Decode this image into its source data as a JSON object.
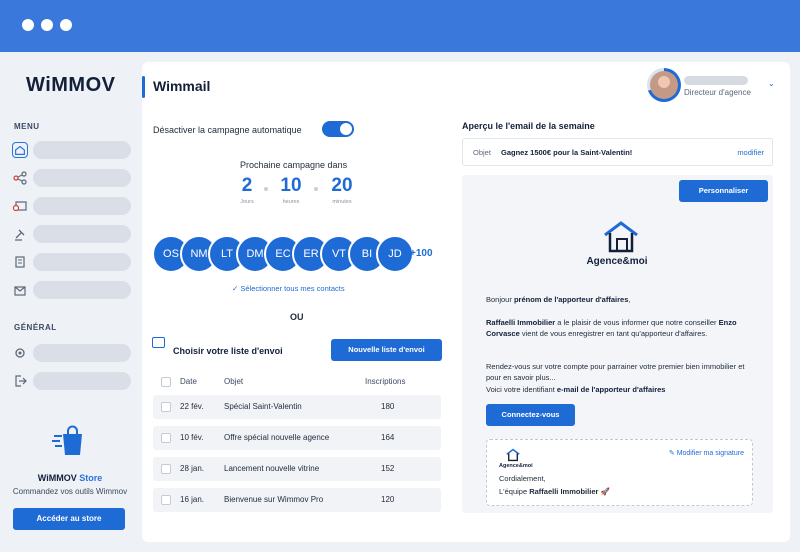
{
  "app": {
    "logo": "WiMMOV",
    "page_title": "Wimmail"
  },
  "user": {
    "role": "Directeur d'agence",
    "chevron": "⌄"
  },
  "sidebar": {
    "menu_label": "MENU",
    "general_label": "GÉNÉRAL",
    "menu_items": [
      {
        "icon": "home-icon"
      },
      {
        "icon": "share-icon"
      },
      {
        "icon": "mail-share-icon"
      },
      {
        "icon": "gavel-icon"
      },
      {
        "icon": "document-icon"
      },
      {
        "icon": "inbox-icon"
      }
    ],
    "general_items": [
      {
        "icon": "gear-icon"
      },
      {
        "icon": "logout-icon"
      }
    ],
    "store": {
      "title_part1": "WiMMOV",
      "title_part2": " Store",
      "subtitle": "Commandez vos outils Wimmov",
      "button": "Accéder au store"
    }
  },
  "campaign": {
    "toggle_label": "Désactiver la campagne automatique",
    "toggle_on": true,
    "next_label": "Prochaine campagne dans",
    "countdown": [
      {
        "value": "2",
        "unit": "Jours"
      },
      {
        "value": "10",
        "unit": "heures"
      },
      {
        "value": "20",
        "unit": "minutes"
      }
    ],
    "contacts": [
      "OS",
      "NM",
      "LT",
      "DM",
      "EC",
      "ER",
      "VT",
      "BI",
      "JD"
    ],
    "more_contacts": "+100",
    "select_all": "✓  Sélectionner tous mes contacts",
    "or": "OU"
  },
  "lists": {
    "title": "Choisir votre liste d'envoi",
    "new_button": "Nouvelle liste d'envoi",
    "headers": {
      "date": "Date",
      "object": "Objet",
      "subs": "Inscriptions"
    },
    "rows": [
      {
        "date": "22 fév.",
        "object": "Spécial Saint-Valentin",
        "subs": "180"
      },
      {
        "date": "10 fév.",
        "object": "Offre spécial nouvelle agence",
        "subs": "164"
      },
      {
        "date": "28 jan.",
        "object": "Lancement nouvelle vitrine",
        "subs": "152"
      },
      {
        "date": "16 jan.",
        "object": "Bienvenue sur Wimmov Pro",
        "subs": "120"
      }
    ]
  },
  "preview": {
    "title": "Aperçu le l'email de la semaine",
    "subject_label": "Objet",
    "subject": "Gagnez 1500€ pour la Saint-Valentin!",
    "modify": "modifier",
    "personalize": "Personnaliser",
    "brand": "Agence&moi",
    "greeting_pre": "Bonjour ",
    "greeting_bold": "prénom de l'apporteur d'affaires",
    "greeting_post": ",",
    "p1_agency": "Raffaelli Immobilier",
    "p1_mid": " a le plaisir de vous informer que notre conseiller ",
    "p1_name": "Enzo Corvasce",
    "p1_end": " vient de vous enregistrer en tant qu'apporteur d'affaires.",
    "p2": "Rendez-vous sur votre compte pour parrainer votre premier bien immobilier et pour en savoir plus...",
    "p3_pre": "Voici votre identifiant ",
    "p3_bold": "e-mail de l'apporteur d'affaires",
    "connect": "Connectez-vous",
    "signature": {
      "brand": "Agence&moi",
      "modify": "Modifier ma signature",
      "line1": "Cordialement,",
      "line2_pre": "L'équipe ",
      "line2_bold": "Raffaelli Immobilier",
      "line2_emoji": " 🚀"
    }
  },
  "colors": {
    "accent": "#1f6bd6",
    "titlebar": "#3a78dc"
  }
}
